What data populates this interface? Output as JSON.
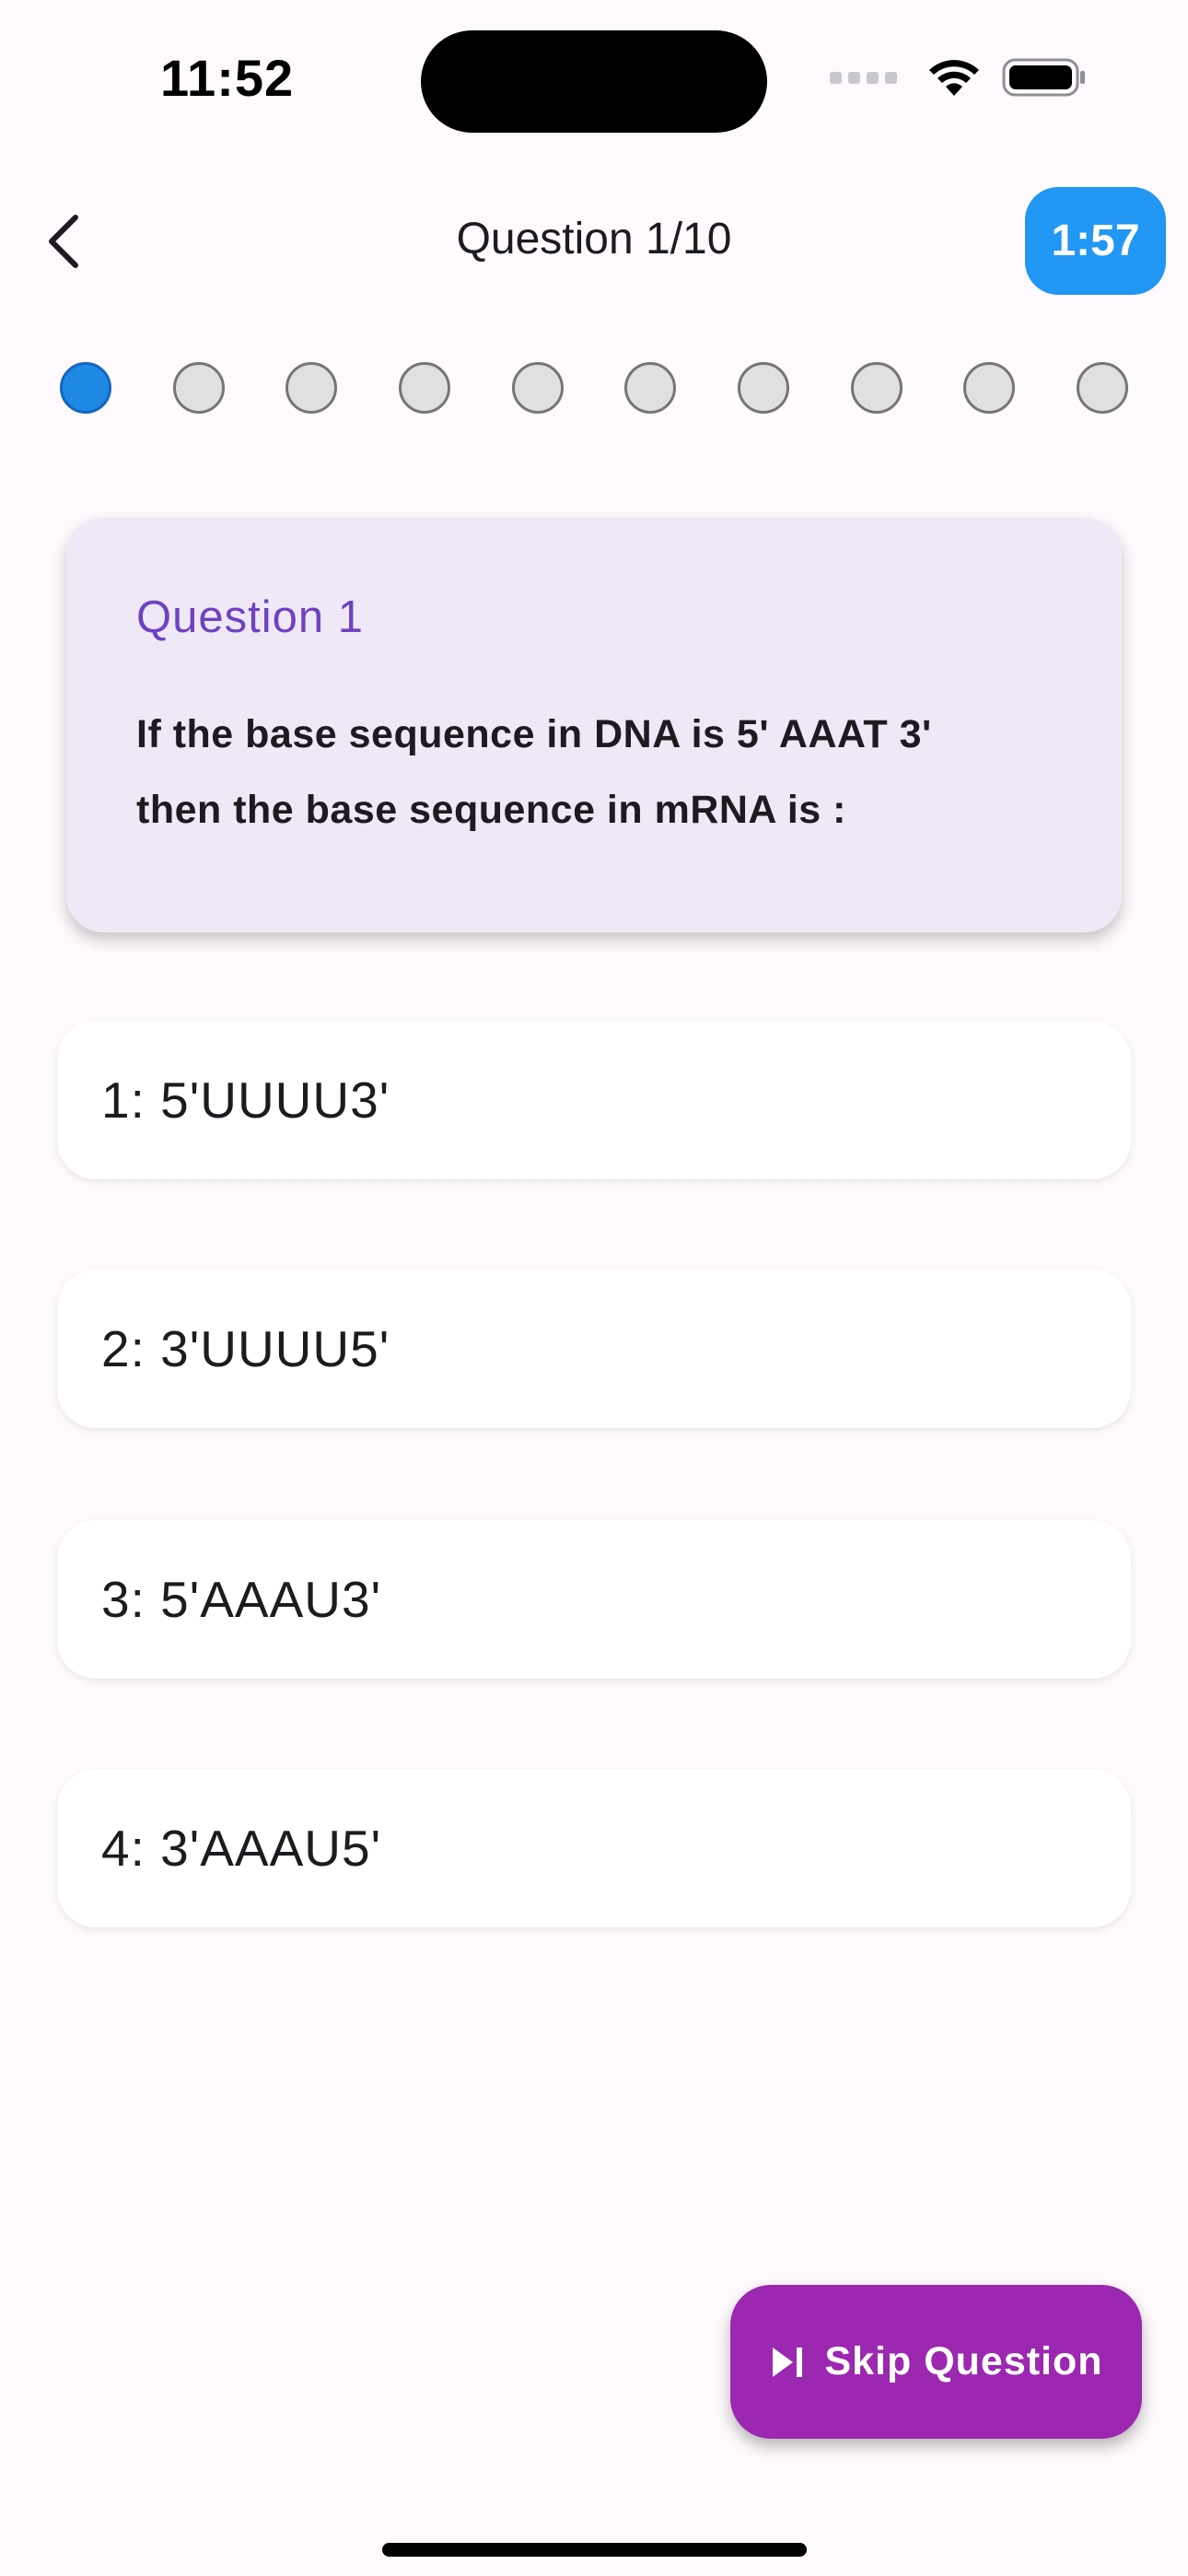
{
  "status_bar": {
    "time": "11:52"
  },
  "app_bar": {
    "title": "Question 1/10",
    "timer": "1:57"
  },
  "progress": {
    "total": 10,
    "current": 1
  },
  "question": {
    "label": "Question 1",
    "text_line1": "If the base sequence in DNA is 5' AAAT 3'",
    "text_line2": "then the base sequence in mRNA is :"
  },
  "options": [
    {
      "label": "1: 5'UUUU3'"
    },
    {
      "label": "2: 3'UUUU5'"
    },
    {
      "label": "3: 5'AAAU3'"
    },
    {
      "label": "4: 3'AAAU5'"
    }
  ],
  "skip_button": {
    "label": "Skip Question",
    "icon": "skip-next-icon"
  },
  "colors": {
    "background": "#fdf9fc",
    "timer_badge": "#2196f3",
    "active_dot": "#1e88e5",
    "question_card": "#efe9f7",
    "question_label": "#6f42c1",
    "skip_button": "#9c27b0"
  }
}
